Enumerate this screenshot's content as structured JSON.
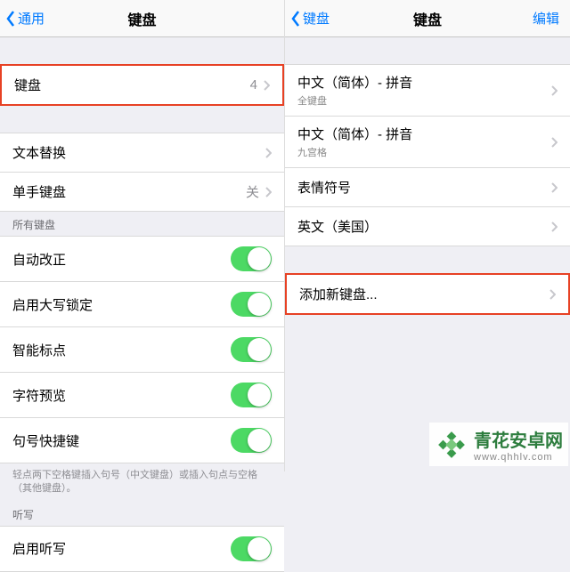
{
  "left": {
    "back_label": "通用",
    "title": "键盘",
    "row_keyboards": {
      "label": "键盘",
      "value": "4"
    },
    "row_text_replace": {
      "label": "文本替换"
    },
    "row_onehand": {
      "label": "单手键盘",
      "value": "关"
    },
    "section_allkb": "所有键盘",
    "toggles": [
      {
        "label": "自动改正"
      },
      {
        "label": "启用大写锁定"
      },
      {
        "label": "智能标点"
      },
      {
        "label": "字符预览"
      },
      {
        "label": "句号快捷键"
      }
    ],
    "footnote": "轻点两下空格键插入句号（中文键盘）或插入句点与空格（其他键盘）。",
    "section_dictation": "听写",
    "row_dictation": {
      "label": "启用听写"
    }
  },
  "right": {
    "back_label": "键盘",
    "title": "键盘",
    "edit_label": "编辑",
    "keyboards": [
      {
        "label": "中文（简体）- 拼音",
        "sub": "全键盘"
      },
      {
        "label": "中文（简体）- 拼音",
        "sub": "九宫格"
      },
      {
        "label": "表情符号"
      },
      {
        "label": "英文（美国）"
      }
    ],
    "add_label": "添加新键盘..."
  },
  "watermark": {
    "brand": "青花安卓网",
    "url": "www.qhhlv.com"
  }
}
